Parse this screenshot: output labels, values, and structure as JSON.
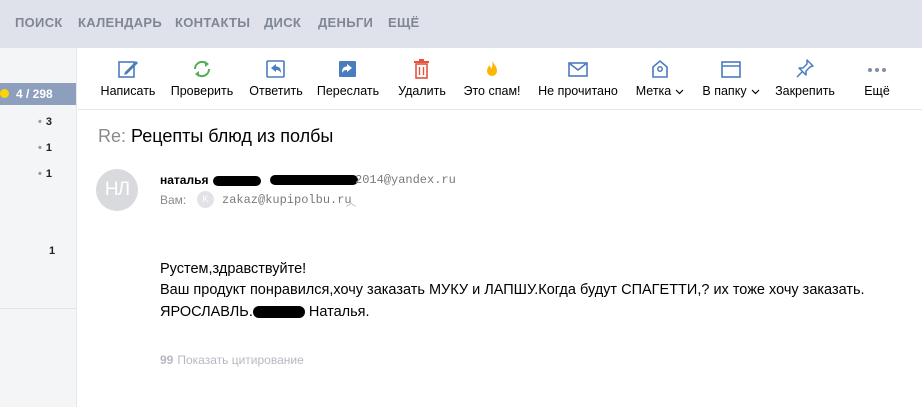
{
  "topnav": {
    "items": [
      "ПОИСК",
      "КАЛЕНДАРЬ",
      "КОНТАКТЫ",
      "ДИСК",
      "ДЕНЬГИ",
      "ЕЩЁ"
    ]
  },
  "sidebar": {
    "counter": "4 / 298",
    "counts": [
      "3",
      "1",
      "1",
      "1"
    ]
  },
  "toolbar": {
    "write": "Написать",
    "check": "Проверить",
    "reply": "Ответить",
    "forward": "Переслать",
    "delete": "Удалить",
    "spam": "Это спам!",
    "unread": "Не прочитано",
    "label": "Метка",
    "folder": "В папку",
    "pin": "Закрепить",
    "more": "Ещё"
  },
  "message": {
    "subject_prefix": "Re:",
    "subject": "Рецепты блюд из полбы",
    "avatar_initials": "НЛ",
    "sender_name": "наталья",
    "sender_email_visible": "2014@yandex.ru",
    "to_label": "Вам:",
    "to_avatar": "K",
    "to_email": "zakaz@kupipolbu.ru",
    "body": {
      "line1": "Рустем,здравствуйте!",
      "line2": "Ваш продукт понравился,хочу заказать МУКУ и ЛАПШУ.Когда будут СПАГЕТТИ,? их тоже хочу заказать.",
      "line3_prefix": "ЯРОСЛАВЛЬ.",
      "line3_suffix": " Наталья."
    },
    "show_quote": "Показать цитирование",
    "quote_glyph": "99"
  },
  "colors": {
    "topnav_bg": "#dfe2ea",
    "counter_bg": "#8e9fbe",
    "check_icon": "#4caf50",
    "delete_icon": "#e5533b",
    "spam_icon": "#ffb400",
    "default_icon": "#4a7cc0"
  }
}
